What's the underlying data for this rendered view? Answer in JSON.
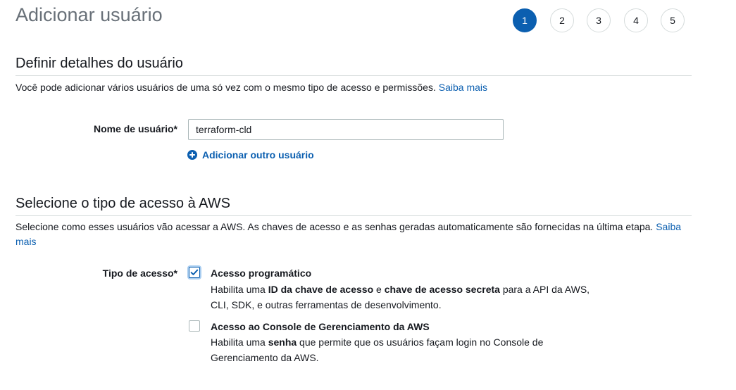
{
  "page": {
    "title": "Adicionar usuário"
  },
  "steps": [
    {
      "label": "1",
      "active": true
    },
    {
      "label": "2",
      "active": false
    },
    {
      "label": "3",
      "active": false
    },
    {
      "label": "4",
      "active": false
    },
    {
      "label": "5",
      "active": false
    }
  ],
  "details_section": {
    "title": "Definir detalhes do usuário",
    "description": "Você pode adicionar vários usuários de uma só vez com o mesmo tipo de acesso e permissões.",
    "learn_more": "Saiba mais",
    "username_label": "Nome de usuário*",
    "username_value": "terraform-cld",
    "add_another_user": "Adicionar outro usuário"
  },
  "access_section": {
    "title": "Selecione o tipo de acesso à AWS",
    "description": "Selecione como esses usuários vão acessar a AWS. As chaves de acesso e as senhas geradas automaticamente são fornecidas na última etapa.",
    "learn_more": "Saiba mais",
    "access_type_label": "Tipo de acesso*",
    "options": [
      {
        "title": "Acesso programático",
        "checked": true,
        "desc_1": "Habilita uma ",
        "desc_bold_1": "ID da chave de acesso",
        "desc_2": " e ",
        "desc_bold_2": "chave de acesso secreta",
        "desc_3": " para a API da AWS, CLI, SDK, e outras ferramentas de desenvolvimento."
      },
      {
        "title": "Acesso ao Console de Gerenciamento da AWS",
        "checked": false,
        "desc_1": "Habilita uma ",
        "desc_bold_1": "senha",
        "desc_2": " que permite que os usuários façam login no Console de Gerenciamento da AWS."
      }
    ]
  },
  "colors": {
    "accent": "#0b5fb0",
    "title_gray": "#687078",
    "border": "#d5dbdb"
  },
  "icons": {
    "add": "plus-circle-icon",
    "check": "checkmark-icon"
  }
}
